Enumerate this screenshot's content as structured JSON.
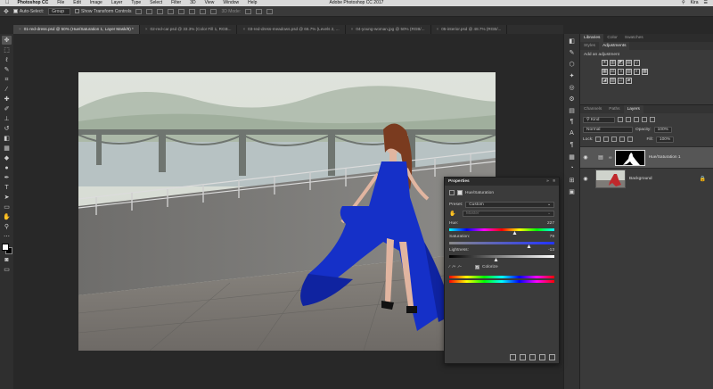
{
  "menubar": {
    "apple": "",
    "items": [
      "Photoshop CC",
      "File",
      "Edit",
      "Image",
      "Layer",
      "Type",
      "Select",
      "Filter",
      "3D",
      "View",
      "Window",
      "Help"
    ],
    "window_title": "Adobe Photoshop CC 2017",
    "right_items": [
      "⚲",
      "Kira",
      "☰"
    ]
  },
  "options": {
    "move_icon": "✥",
    "auto_select_label": "Auto-Select:",
    "auto_select_value": "Group",
    "show_transform_label": "Show Transform Controls",
    "mode_3d_label": "3D Mode:"
  },
  "tabs": [
    {
      "label": "01-red-dress.psd @ 50% (Hue/Saturation 1, Layer Mask/8) *",
      "active": true
    },
    {
      "label": "02-red-car.psd @ 33.3% (Color Fill 1, RGB...",
      "active": false
    },
    {
      "label": "03-red-dress-meadows.psd @ 66.7% (Levels 2, ...",
      "active": false
    },
    {
      "label": "04-young-woman.jpg @ 50% (RGB/...",
      "active": false
    },
    {
      "label": "05-interior.psd @ 48.7% (RGB/...",
      "active": false
    }
  ],
  "tools": [
    {
      "name": "move-tool",
      "glyph": "✥"
    },
    {
      "name": "marquee-tool",
      "glyph": "⬚"
    },
    {
      "name": "lasso-tool",
      "glyph": "ℓ"
    },
    {
      "name": "quick-select-tool",
      "glyph": "✎"
    },
    {
      "name": "crop-tool",
      "glyph": "⌗"
    },
    {
      "name": "eyedropper-tool",
      "glyph": "⁄"
    },
    {
      "name": "healing-tool",
      "glyph": "✚"
    },
    {
      "name": "brush-tool",
      "glyph": "✐"
    },
    {
      "name": "clone-stamp-tool",
      "glyph": "⊥"
    },
    {
      "name": "history-brush-tool",
      "glyph": "↺"
    },
    {
      "name": "eraser-tool",
      "glyph": "◧"
    },
    {
      "name": "gradient-tool",
      "glyph": "▦"
    },
    {
      "name": "blur-tool",
      "glyph": "◆"
    },
    {
      "name": "dodge-tool",
      "glyph": "●"
    },
    {
      "name": "pen-tool",
      "glyph": "✒"
    },
    {
      "name": "type-tool",
      "glyph": "T"
    },
    {
      "name": "path-select-tool",
      "glyph": "➤"
    },
    {
      "name": "shape-tool",
      "glyph": "▭"
    },
    {
      "name": "hand-tool",
      "glyph": "✋"
    },
    {
      "name": "zoom-tool",
      "glyph": "⚲"
    },
    {
      "name": "extras-tool",
      "glyph": "⋯"
    }
  ],
  "dock_icons": [
    "◧",
    "✎",
    "⬡",
    "✦",
    "◎",
    "⚙",
    "▤",
    "¶",
    "A",
    "¶",
    "▦",
    "◔",
    "⊞",
    "▣"
  ],
  "panels": {
    "top_tabs": [
      "Libraries",
      "Color",
      "Swatches"
    ],
    "sub_tabs": [
      "Styles",
      "Adjustments"
    ],
    "adjustments_title": "Add an adjustment",
    "adj_row1": [
      "☀",
      "▥",
      "◩",
      "▤",
      "▽"
    ],
    "adj_row2": [
      "▦",
      "⚖",
      "◑",
      "▧",
      "◐",
      "▩"
    ],
    "adj_row3": [
      "◪",
      "▨",
      "▱",
      "▰"
    ],
    "layer_tabs": [
      "Channels",
      "Paths",
      "Layers"
    ],
    "kind_filter": "Kind",
    "blend_mode": "Normal",
    "opacity_label": "Opacity:",
    "opacity_value": "100%",
    "lock_label": "Lock:",
    "fill_label": "Fill:",
    "fill_value": "100%",
    "layers": [
      {
        "name": "Hue/Saturation 1",
        "selected": true
      },
      {
        "name": "Background",
        "selected": false
      }
    ],
    "eye_glyph": "◉",
    "lock_glyph": "🔒"
  },
  "properties": {
    "title": "Properties",
    "collapse_glyph": "»",
    "menu_glyph": "≡",
    "subtitle": "Hue/Saturation",
    "preset_label": "Preset:",
    "preset_value": "Custom",
    "channel_value": "Master",
    "hand_glyph": "✋",
    "hue_label": "Hue:",
    "hue_value": "227",
    "saturation_label": "Saturation:",
    "saturation_value": "79",
    "lightness_label": "Lightness:",
    "lightness_value": "-13",
    "colorize_label": "Colorize",
    "colorize_check": "✓",
    "eyedroppers": [
      "⁄",
      "⁄+",
      "⁄−"
    ]
  },
  "colors": {
    "dress": "#1530c8",
    "selected_layer": "#565656",
    "panel": "#3a3a3a"
  }
}
